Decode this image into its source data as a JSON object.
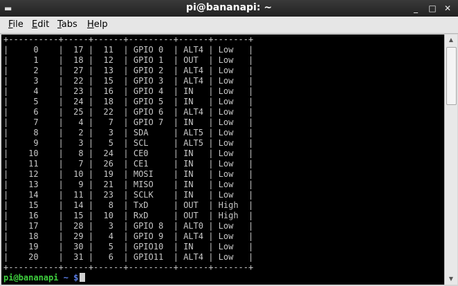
{
  "window": {
    "title": "pi@bananapi: ~",
    "menu_icon": "terminal-menu-icon",
    "buttons": {
      "minimize": "_",
      "maximize": "□",
      "close": "✕"
    }
  },
  "menu": [
    {
      "mnemonic": "F",
      "rest": "ile"
    },
    {
      "mnemonic": "E",
      "rest": "dit"
    },
    {
      "mnemonic": "T",
      "rest": "abs"
    },
    {
      "mnemonic": "H",
      "rest": "elp"
    }
  ],
  "terminal": {
    "separator": "+----------+-----+------+---------+------+-------+",
    "rows": [
      "|     0    |  17 |  11  | GPIO 0  | ALT4 | Low   |",
      "|     1    |  18 |  12  | GPIO 1  | OUT  | Low   |",
      "|     2    |  27 |  13  | GPIO 2  | ALT4 | Low   |",
      "|     3    |  22 |  15  | GPIO 3  | ALT4 | Low   |",
      "|     4    |  23 |  16  | GPIO 4  | IN   | Low   |",
      "|     5    |  24 |  18  | GPIO 5  | IN   | Low   |",
      "|     6    |  25 |  22  | GPIO 6  | ALT4 | Low   |",
      "|     7    |   4 |   7  | GPIO 7  | IN   | Low   |",
      "|     8    |   2 |   3  | SDA     | ALT5 | Low   |",
      "|     9    |   3 |   5  | SCL     | ALT5 | Low   |",
      "|    10    |   8 |  24  | CE0     | IN   | Low   |",
      "|    11    |   7 |  26  | CE1     | IN   | Low   |",
      "|    12    |  10 |  19  | MOSI    | IN   | Low   |",
      "|    13    |   9 |  21  | MISO    | IN   | Low   |",
      "|    14    |  11 |  23  | SCLK    | IN   | Low   |",
      "|    15    |  14 |   8  | TxD     | OUT  | High  |",
      "|    16    |  15 |  10  | RxD     | OUT  | High  |",
      "|    17    |  28 |   3  | GPIO 8  | ALT0 | Low   |",
      "|    18    |  29 |   4  | GPIO 9  | ALT4 | Low   |",
      "|    19    |  30 |   5  | GPIO10  | IN   | Low   |",
      "|    20    |  31 |   6  | GPIO11  | ALT4 | Low   |"
    ],
    "prompt_user": "pi@bananapi",
    "prompt_path": " ~ $",
    "colors": {
      "user": "#3ecf3e",
      "path": "#5a7ee8",
      "text": "#c8c8c8",
      "background": "#000000"
    }
  }
}
